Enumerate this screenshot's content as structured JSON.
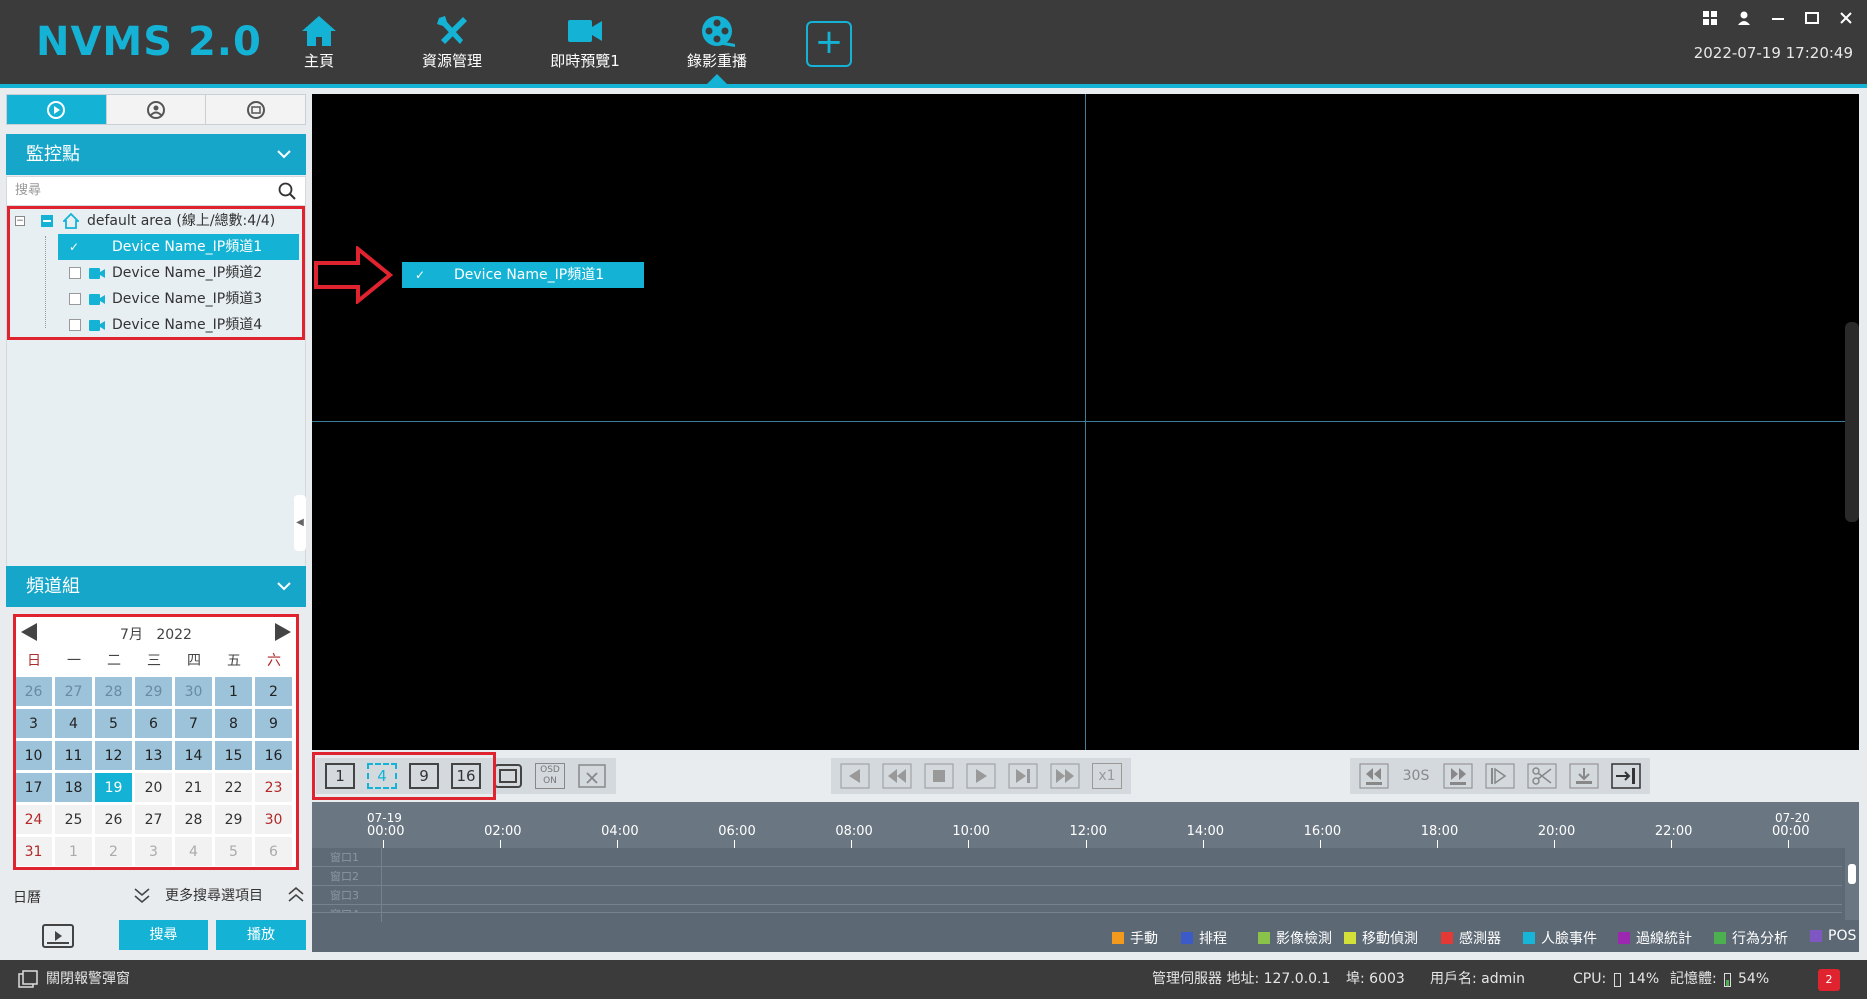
{
  "app": {
    "logo": "NVMS 2.0",
    "datetime": "2022-07-19 17:20:49"
  },
  "nav": [
    {
      "label": "主頁",
      "icon": "home-icon"
    },
    {
      "label": "資源管理",
      "icon": "tools-icon"
    },
    {
      "label": "即時預覽1",
      "icon": "camera-icon"
    },
    {
      "label": "錄影重播",
      "icon": "film-reel-icon"
    }
  ],
  "sidebar": {
    "monitor_title": "監控點",
    "search_placeholder": "搜尋",
    "area_label": "default area (線上/總數:4/4)",
    "channels": [
      {
        "label": "Device Name_IP頻道1",
        "checked": true
      },
      {
        "label": "Device Name_IP頻道2",
        "checked": false
      },
      {
        "label": "Device Name_IP頻道3",
        "checked": false
      },
      {
        "label": "Device Name_IP頻道4",
        "checked": false
      }
    ],
    "group_title": "頻道組"
  },
  "calendar": {
    "month": "7月",
    "year": "2022",
    "weekdays": [
      "日",
      "一",
      "二",
      "三",
      "四",
      "五",
      "六"
    ],
    "weeks": [
      [
        "26",
        "27",
        "28",
        "29",
        "30",
        "1",
        "2"
      ],
      [
        "3",
        "4",
        "5",
        "6",
        "7",
        "8",
        "9"
      ],
      [
        "10",
        "11",
        "12",
        "13",
        "14",
        "15",
        "16"
      ],
      [
        "17",
        "18",
        "19",
        "20",
        "21",
        "22",
        "23"
      ],
      [
        "24",
        "25",
        "26",
        "27",
        "28",
        "29",
        "30"
      ],
      [
        "31",
        "1",
        "2",
        "3",
        "4",
        "5",
        "6"
      ]
    ],
    "selected_day": "19",
    "footer_label": "日曆",
    "more_options": "更多搜尋選項目"
  },
  "buttons": {
    "search": "搜尋",
    "play": "播放"
  },
  "drag_item": "Device Name_IP頻道1",
  "toolbar": {
    "layouts": [
      "1",
      "4",
      "9",
      "16"
    ],
    "active_layout": "4",
    "osd": "OSD ON",
    "speed": "x1",
    "skip_label": "30S"
  },
  "timeline": {
    "start_date": "07-19",
    "end_date": "07-20",
    "ticks": [
      "00:00",
      "02:00",
      "04:00",
      "06:00",
      "08:00",
      "10:00",
      "12:00",
      "14:00",
      "16:00",
      "18:00",
      "20:00",
      "22:00",
      "00:00"
    ],
    "rows": [
      "窗口1",
      "窗口2",
      "窗口3",
      "窗口4"
    ]
  },
  "legend": [
    {
      "label": "手動",
      "color": "#f39a1e"
    },
    {
      "label": "排程",
      "color": "#3c5ac8"
    },
    {
      "label": "影像檢測",
      "color": "#8bc34a"
    },
    {
      "label": "移動偵測",
      "color": "#d4e03a"
    },
    {
      "label": "感測器",
      "color": "#e53935"
    },
    {
      "label": "人臉事件",
      "color": "#17b6d8"
    },
    {
      "label": "過線統計",
      "color": "#9c27b0"
    },
    {
      "label": "行為分析",
      "color": "#4caf50"
    },
    {
      "label": "POS",
      "color": "#7e57c2"
    }
  ],
  "status": {
    "close_alarm": "關閉報警彈窗",
    "server": "管理伺服器 地址: 127.0.0.1",
    "port": "埠: 6003",
    "user": "用戶名: admin",
    "cpu": "CPU:",
    "cpu_value": "14%",
    "memory": "記憶體:",
    "memory_value": "54%",
    "alarm_count": "2"
  }
}
